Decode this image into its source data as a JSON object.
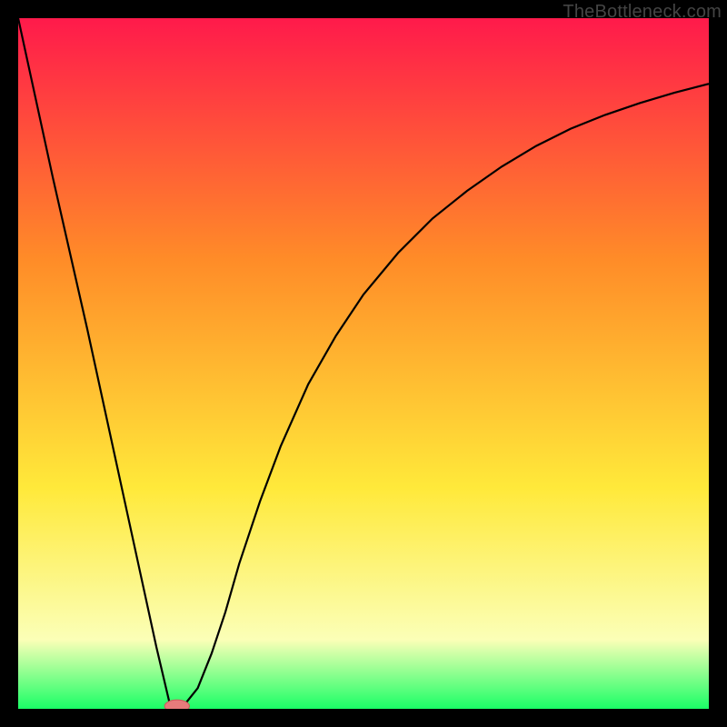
{
  "watermark": "TheBottleneck.com",
  "colors": {
    "frame": "#000000",
    "gradient_top": "#ff1a4b",
    "gradient_mid": "#ff8c28",
    "gradient_low": "#ffe93a",
    "gradient_pale": "#fbffb7",
    "gradient_bottom": "#1aff66",
    "curve": "#000000",
    "marker_fill": "#e77b7b",
    "marker_stroke": "#c95b5b"
  },
  "chart_data": {
    "type": "line",
    "title": "",
    "xlabel": "",
    "ylabel": "",
    "xlim": [
      0,
      100
    ],
    "ylim": [
      0,
      100
    ],
    "series": [
      {
        "name": "curve",
        "x": [
          0,
          5,
          10,
          15,
          20,
          22,
          23,
          24,
          26,
          28,
          30,
          32,
          35,
          38,
          42,
          46,
          50,
          55,
          60,
          65,
          70,
          75,
          80,
          85,
          90,
          95,
          100
        ],
        "y": [
          100,
          77,
          55,
          32,
          9,
          0.5,
          0,
          0.5,
          3,
          8,
          14,
          21,
          30,
          38,
          47,
          54,
          60,
          66,
          71,
          75,
          78.5,
          81.5,
          84,
          86,
          87.7,
          89.2,
          90.5
        ]
      }
    ],
    "marker": {
      "x": 23,
      "y": 0,
      "rx": 1.8,
      "ry": 0.9
    }
  }
}
